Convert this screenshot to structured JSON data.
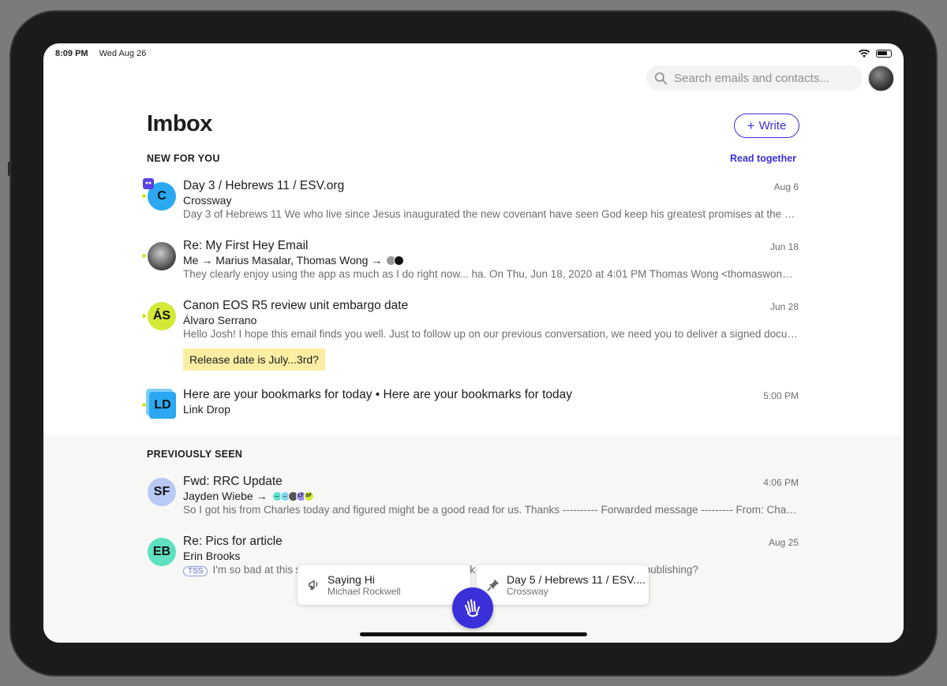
{
  "status": {
    "time": "8:09 PM",
    "date": "Wed Aug 26"
  },
  "search": {
    "placeholder": "Search emails and contacts..."
  },
  "header": {
    "title": "Imbox",
    "write_label": "Write",
    "write_plus": "+"
  },
  "sections": {
    "new": "NEW FOR YOU",
    "read_together": "Read together",
    "previous": "PREVIOUSLY SEEN"
  },
  "new_emails": [
    {
      "avatar": "C",
      "avatar_color": "#2aa8f2",
      "subject": "Day 3 / Hebrews 11 / ESV.org",
      "sender": "Crossway",
      "date": "Aug 6",
      "snippet": "Day 3 of Hebrews 11 We who live since Jesus inaugurated the new covenant have seen God keep his greatest promises at the cross."
    },
    {
      "avatar": "",
      "subject": "Re: My First Hey Email",
      "sender": "Me → Marius Masalar, Thomas Wong →",
      "date": "Jun 18",
      "snippet": "They clearly enjoy using the app as much as I do right now... ha. On Thu, Jun 18, 2020 at 4:01 PM Thomas Wong <thomaswong@hey.com> wrote:"
    },
    {
      "avatar": "ÁS",
      "avatar_color": "#d4e837",
      "subject": "Canon EOS R5 review unit embargo date",
      "sender": "Álvaro Serrano",
      "date": "Jun 28",
      "snippet": "Hello Josh! I hope this email finds you well. Just to follow up on our previous conversation, we need you to deliver a signed document.",
      "note": "Release date is July...3rd?"
    },
    {
      "avatar": "LD",
      "avatar_color": "#2aa8f2",
      "subject": "Here are your bookmarks for today • Here are your bookmarks for today",
      "sender": "Link Drop",
      "date": "5:00 PM"
    }
  ],
  "previous_emails": [
    {
      "avatar": "SF",
      "avatar_color": "#b9c9f5",
      "subject": "Fwd: RRC Update",
      "sender": "Jayden Wiebe →",
      "date": "4:06 PM",
      "snippet": "So I got his from Charles today and figured might be a good read for us. Thanks ---------- Forwarded message --------- From: Charles"
    },
    {
      "avatar": "EB",
      "avatar_color": "#5fe0c0",
      "subject": "Re:  Pics for article",
      "sender": "Erin Brooks",
      "date": "Aug 25",
      "badge": "TSS",
      "snippet": "I'm so bad at this stuff. Do you want to take a quick look and give it a quick last pass before publishing?"
    }
  ],
  "mini_avatars": [
    "...",
    "...",
    "",
    "LT",
    "SF"
  ],
  "tray": [
    {
      "title": "Saying Hi",
      "subtitle": "Michael Rockwell"
    },
    {
      "title": "Day 5 / Hebrews 11 / ESV....",
      "subtitle": "Crossway"
    }
  ],
  "colors": {
    "accent": "#3b2fd9",
    "unread_dot": "#d6e42b",
    "note": "#fbeea3"
  }
}
